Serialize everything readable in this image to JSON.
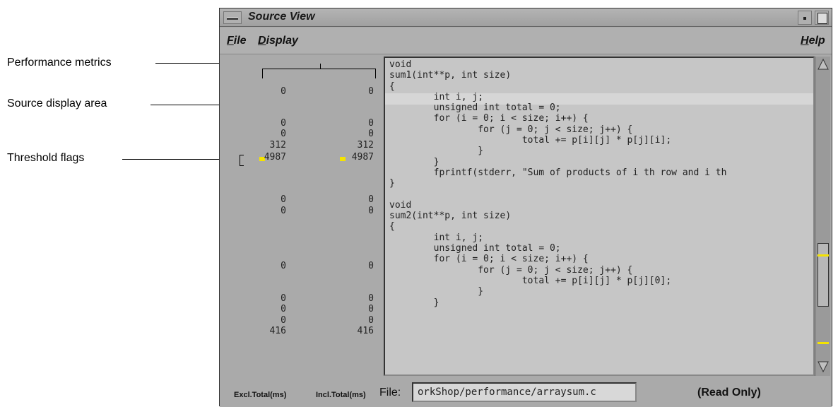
{
  "callouts": {
    "performance_metrics": "Performance metrics",
    "source_display_area": "Source display area",
    "threshold_flags": "Threshold flags"
  },
  "window": {
    "title": "Source View",
    "menu": {
      "file": "File",
      "display": "Display",
      "help": "Help"
    }
  },
  "metrics": {
    "excl": [
      "0",
      "0",
      "0",
      "312",
      "4987",
      "0",
      "0",
      "0",
      "0",
      "0",
      "0",
      "416"
    ],
    "incl": [
      "0",
      "0",
      "0",
      "312",
      "4987",
      "0",
      "0",
      "0",
      "0",
      "0",
      "0",
      "416"
    ]
  },
  "source": {
    "code": "void\nsum1(int**p, int size)\n{\n        int i, j;\n        unsigned int total = 0;\n        for (i = 0; i < size; i++) {\n                for (j = 0; j < size; j++) {\n                        total += p[i][j] * p[j][i];\n                }\n        }\n        fprintf(stderr, \"Sum of products of i th row and i th\n}\n\nvoid\nsum2(int**p, int size)\n{\n        int i, j;\n        unsigned int total = 0;\n        for (i = 0; i < size; i++) {\n                for (j = 0; j < size; j++) {\n                        total += p[i][j] * p[j][0];\n                }\n        }"
  },
  "bottom": {
    "excl_label": "Excl.Total(ms)",
    "incl_label": "Incl.Total(ms)",
    "file_label": "File:",
    "file_value": "orkShop/performance/arraysum.c",
    "readonly": "(Read Only)"
  },
  "colors": {
    "flag": "#f4e300",
    "window_bg": "#aaaaaa",
    "source_bg": "#c6c6c6"
  }
}
